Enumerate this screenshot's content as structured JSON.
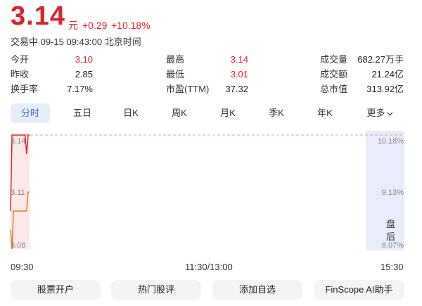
{
  "quote": {
    "price": "3.14",
    "unit": "元",
    "change": "+0.29",
    "change_pct": "+10.18%",
    "status_line": "交易中 09-15 09:43:00 北京时间"
  },
  "stats": [
    {
      "label": "今开",
      "value": "3.10",
      "color": "red"
    },
    {
      "label": "最高",
      "value": "3.14",
      "color": "red"
    },
    {
      "label": "成交量",
      "value": "682.27万手",
      "color": "dark"
    },
    {
      "label": "昨收",
      "value": "2.85",
      "color": "dark"
    },
    {
      "label": "最低",
      "value": "3.01",
      "color": "red"
    },
    {
      "label": "成交额",
      "value": "21.24亿",
      "color": "dark"
    },
    {
      "label": "换手率",
      "value": "7.17%",
      "color": "dark"
    },
    {
      "label": "市盈(TTM)",
      "value": "37.32",
      "color": "dark"
    },
    {
      "label": "总市值",
      "value": "313.92亿",
      "color": "dark"
    }
  ],
  "tabs": [
    "分时",
    "五日",
    "日K",
    "周K",
    "月K",
    "季K",
    "年K",
    "更多"
  ],
  "active_tab": 0,
  "chart_data": {
    "type": "line",
    "title": "",
    "x_time_labels": [
      "09:30",
      "11:30/13:00",
      "15:30"
    ],
    "y_left_ticks": [
      "3.14",
      "3.11",
      "3.08"
    ],
    "y_right_ticks": [
      "10.18%",
      "9.13%",
      "8.07%"
    ],
    "ylim": [
      3.08,
      3.14
    ],
    "limit_up_price": 3.14,
    "after_hours_label": "盘后",
    "series": [
      {
        "color": "#e0202a",
        "x": [
          "09:30",
          "09:31",
          "09:32",
          "09:33",
          "09:34",
          "09:35",
          "09:36",
          "09:37",
          "09:38",
          "09:39",
          "09:40",
          "09:41",
          "09:42",
          "09:43"
        ],
        "values": [
          3.1,
          3.14,
          3.14,
          3.14,
          3.14,
          3.14,
          3.14,
          3.14,
          3.14,
          3.14,
          3.14,
          3.13,
          3.14,
          3.14
        ]
      },
      {
        "color": "#f07a1a",
        "x": [
          "09:30",
          "09:31",
          "09:32",
          "09:33",
          "09:34",
          "09:35",
          "09:36",
          "09:37",
          "09:38",
          "09:39",
          "09:40",
          "09:41",
          "09:42",
          "09:43"
        ],
        "values": [
          3.09,
          3.08,
          3.1,
          3.1,
          3.1,
          3.1,
          3.1,
          3.1,
          3.1,
          3.1,
          3.1,
          3.1,
          3.11,
          3.11
        ]
      }
    ],
    "colors": {
      "up": "#e0202a",
      "avg": "#f07a1a",
      "after_hours_bg": "#e8ecfb",
      "accent": "#3b6fd6"
    }
  },
  "bottom_buttons": [
    "股票开户",
    "热门股评",
    "添加自选",
    "FinScope AI助手"
  ]
}
